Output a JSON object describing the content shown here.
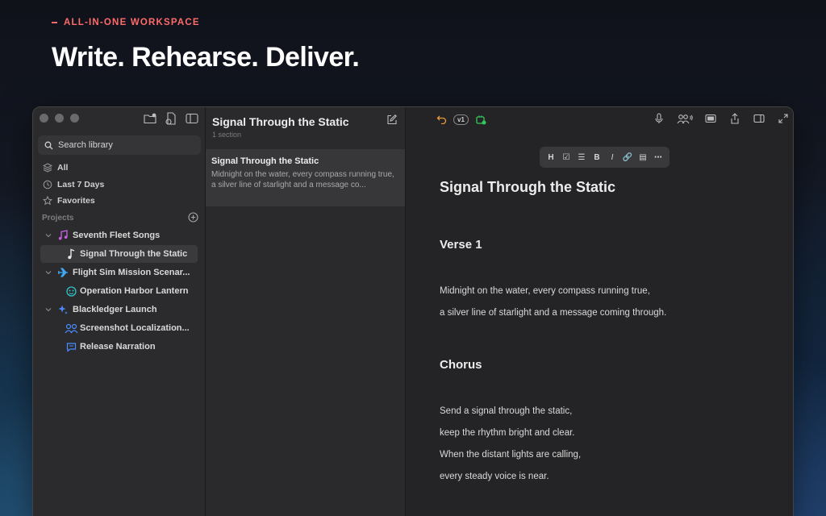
{
  "hero": {
    "eyebrow": "ALL-IN-ONE WORKSPACE",
    "headline": "Write. Rehearse. Deliver."
  },
  "sidebar": {
    "search_placeholder": "Search library",
    "nav": [
      {
        "label": "All",
        "icon": "layers-icon"
      },
      {
        "label": "Last 7 Days",
        "icon": "clock-icon"
      },
      {
        "label": "Favorites",
        "icon": "star-icon"
      }
    ],
    "projects_label": "Projects",
    "tree": [
      {
        "label": "Seventh Fleet Songs",
        "icon": "music-notes-icon",
        "level": 0
      },
      {
        "label": "Signal Through the Static",
        "icon": "music-note-icon",
        "level": 1,
        "selected": true
      },
      {
        "label": "Flight Sim Mission Scenar...",
        "icon": "airplane-icon",
        "level": 0
      },
      {
        "label": "Operation Harbor Lantern",
        "icon": "globe-icon",
        "level": 1
      },
      {
        "label": "Blackledger Launch",
        "icon": "sparkle-icon",
        "level": 0
      },
      {
        "label": "Screenshot Localization...",
        "icon": "people-icon",
        "level": 1
      },
      {
        "label": "Release Narration",
        "icon": "chat-icon",
        "level": 1
      }
    ]
  },
  "list": {
    "title": "Signal Through the Static",
    "subtitle": "1 section",
    "card_title": "Signal Through the Static",
    "card_preview": "Midnight on the water, every compass running true, a silver line of starlight and a message co..."
  },
  "editor": {
    "version_badge": "v1",
    "format_toolbar": [
      "H",
      "☑",
      "☰",
      "B",
      "I",
      "🔗",
      "▤",
      "⋯"
    ],
    "doc_title": "Signal Through the Static",
    "verse_heading": "Verse 1",
    "verse_lines": [
      "Midnight on the water, every compass running true,",
      "a silver line of starlight and a message coming through."
    ],
    "chorus_heading": "Chorus",
    "chorus_lines": [
      "Send a signal through the static,",
      "keep the rhythm bright and clear.",
      "When the distant lights are calling,",
      "every steady voice is near."
    ]
  },
  "colors": {
    "accent_red": "#ff6b6b",
    "music_purple": "#c25ee0",
    "plane_blue": "#3fa9f5",
    "globe_teal": "#2fc3c9",
    "launch_blue": "#4a8cff",
    "green_icon": "#34c759",
    "undo_orange": "#e89a3c"
  }
}
